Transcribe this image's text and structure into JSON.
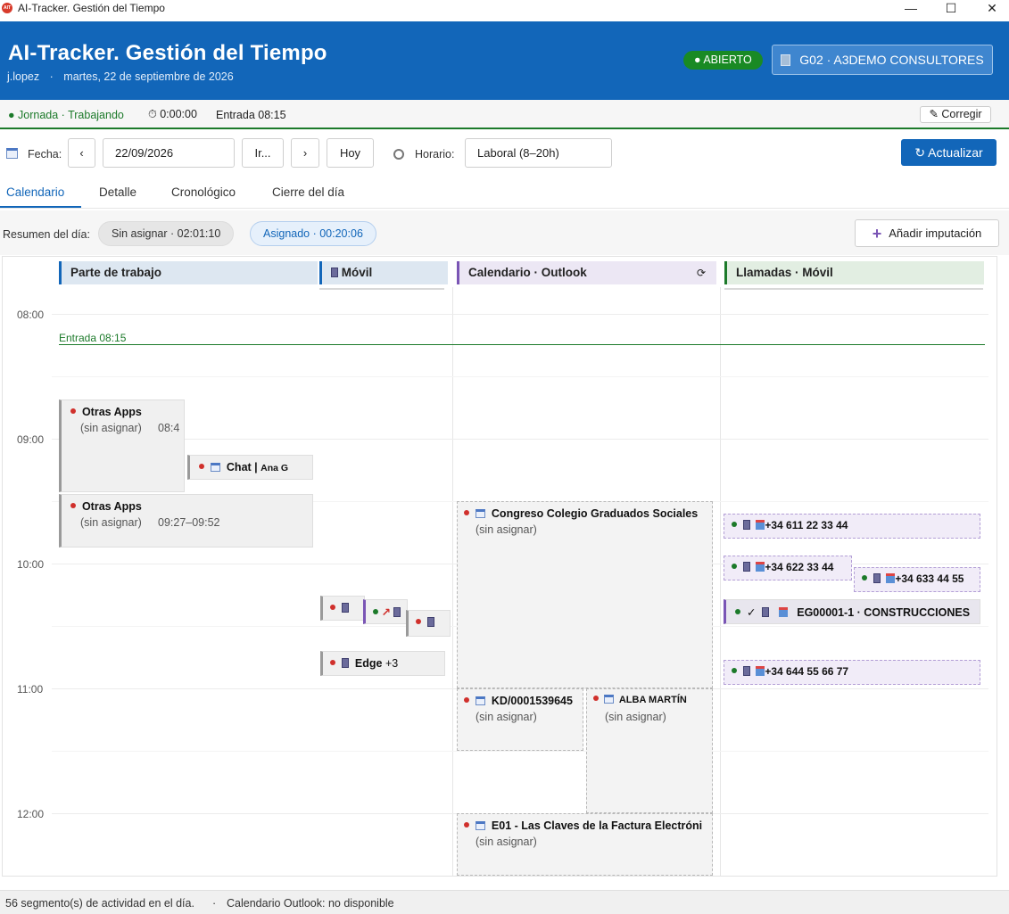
{
  "window": {
    "title": "AI-Tracker. Gestión del Tiempo",
    "logo_text": "AIT",
    "minimize": "—",
    "maximize": "☐",
    "close": "✕"
  },
  "header": {
    "title": "AI-Tracker. Gestión del Tiempo",
    "user": "j.lopez",
    "separator": "·",
    "date": "martes, 22 de septiembre de 2026",
    "status": "● ABIERTO",
    "company": "G02 · A3DEMO CONSULTORES"
  },
  "jornada": {
    "label": "● Jornada · Trabajando",
    "timer": "⏱ 0:00:00",
    "entrada": "Entrada 08:15",
    "corregir": "✎ Corregir"
  },
  "toolbar": {
    "fecha_label": "Fecha:",
    "prev": "‹",
    "date_value": "22/09/2026",
    "go": "Ir...",
    "next": "›",
    "today": "Hoy",
    "horario_label": "Horario:",
    "horario_value": "Laboral (8–20h)",
    "refresh": "↻ Actualizar"
  },
  "tabs": [
    "Calendario",
    "Detalle",
    "Cronológico",
    "Cierre del día"
  ],
  "summary": {
    "label": "Resumen del día:",
    "sin_asignar": "Sin asignar  ·  02:01:10",
    "asignado": "Asignado  ·  00:20:06",
    "add_button": "Añadir imputación"
  },
  "calendar": {
    "columns": [
      {
        "label": "Parte de trabajo",
        "accent": "#1266b9",
        "bg": "#dde7f1"
      },
      {
        "label": "Móvil",
        "accent": "#1266b9",
        "bg": "#dde7f1"
      },
      {
        "label": "Calendario · Outlook",
        "accent": "#7a55b5",
        "bg": "#ece7f4",
        "refresh": "⟳"
      },
      {
        "label": "Llamadas · Móvil",
        "accent": "#1c7a2a",
        "bg": "#e2eee2"
      }
    ],
    "hours": [
      "08:00",
      "09:00",
      "10:00",
      "11:00",
      "12:00"
    ],
    "entrada_marker": "Entrada 08:15",
    "events": {
      "otras_apps_1": {
        "title": "Otras Apps",
        "sub": "(sin asignar)",
        "time": "08:4"
      },
      "chat": {
        "title": "Chat |",
        "extra": "Ana G"
      },
      "otras_apps_2": {
        "title": "Otras Apps",
        "sub": "(sin asignar)",
        "time": "09:27–09:52"
      },
      "movil_edge": {
        "title": "Edge",
        "extra": "+3"
      },
      "congreso": {
        "title": "Congreso Colegio Graduados Sociales",
        "sub": "(sin asignar)"
      },
      "kd": {
        "title": "KD/0001539645",
        "sub": "(sin asignar)"
      },
      "alba": {
        "title": "ALBA MARTÍN",
        "sub": "(sin asignar)"
      },
      "e01": {
        "title": "E01 - Las Claves de la Factura Electróni",
        "sub": "(sin asignar)"
      },
      "call_1": {
        "title": "+34 611 22 33 44"
      },
      "call_2": {
        "title": "+34 622 33 44"
      },
      "call_3": {
        "title": "+34 633 44 55"
      },
      "construcciones": {
        "title": "EG00001-1 · CONSTRUCCIONES",
        "check": "✓"
      },
      "call_4": {
        "title": "+34 644 55 66 77"
      }
    }
  },
  "statusbar": {
    "segments": "56 segmento(s) de actividad en el día.",
    "sep": "·",
    "outlook": "Calendario Outlook: no disponible"
  }
}
